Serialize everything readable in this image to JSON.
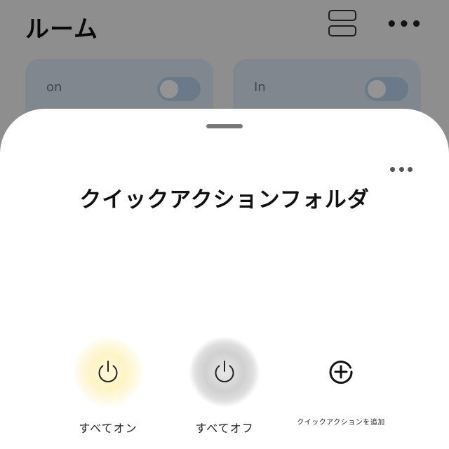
{
  "background": {
    "title": "ルーム",
    "layout_icon": "layout-rows-icon",
    "more_icon": "more-horizontal-icon",
    "more_glyph": "•••",
    "cards": [
      {
        "label": "on",
        "toggle_on": false
      },
      {
        "label": "In",
        "toggle_on": false
      }
    ]
  },
  "sheet": {
    "title": "クイックアクションフォルダ",
    "more_icon": "more-horizontal-icon",
    "actions": [
      {
        "label": "すべてオン",
        "icon": "power-icon",
        "glow_color": "#fdf4c6"
      },
      {
        "label": "すべてオフ",
        "icon": "power-icon",
        "glow_color": "#d0d0d0"
      },
      {
        "label": "クイックアクションを追加",
        "icon": "add-circle-icon"
      }
    ]
  }
}
